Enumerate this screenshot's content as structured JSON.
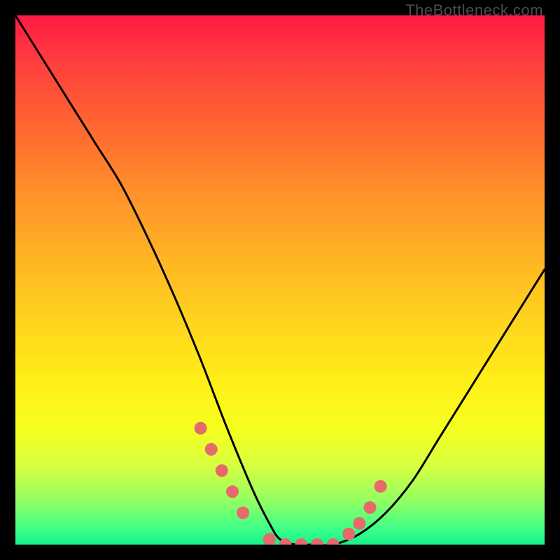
{
  "watermark": "TheBottleneck.com",
  "chart_data": {
    "type": "line",
    "title": "",
    "xlabel": "",
    "ylabel": "",
    "xlim": [
      0,
      100
    ],
    "ylim": [
      0,
      100
    ],
    "series": [
      {
        "name": "bottleneck-curve",
        "x": [
          0,
          5,
          10,
          15,
          20,
          25,
          30,
          35,
          40,
          45,
          48,
          50,
          53,
          56,
          60,
          65,
          70,
          75,
          80,
          85,
          90,
          95,
          100
        ],
        "y": [
          100,
          92,
          84,
          76,
          68,
          58,
          47,
          35,
          22,
          10,
          4,
          1,
          0,
          0,
          0,
          2,
          6,
          12,
          20,
          28,
          36,
          44,
          52
        ]
      }
    ],
    "markers": {
      "name": "highlight-dots",
      "color": "#e66a6a",
      "x": [
        35,
        37,
        39,
        41,
        43,
        48,
        51,
        54,
        57,
        60,
        63,
        65,
        67,
        69
      ],
      "y": [
        22,
        18,
        14,
        10,
        6,
        1,
        0,
        0,
        0,
        0,
        2,
        4,
        7,
        11
      ]
    }
  }
}
